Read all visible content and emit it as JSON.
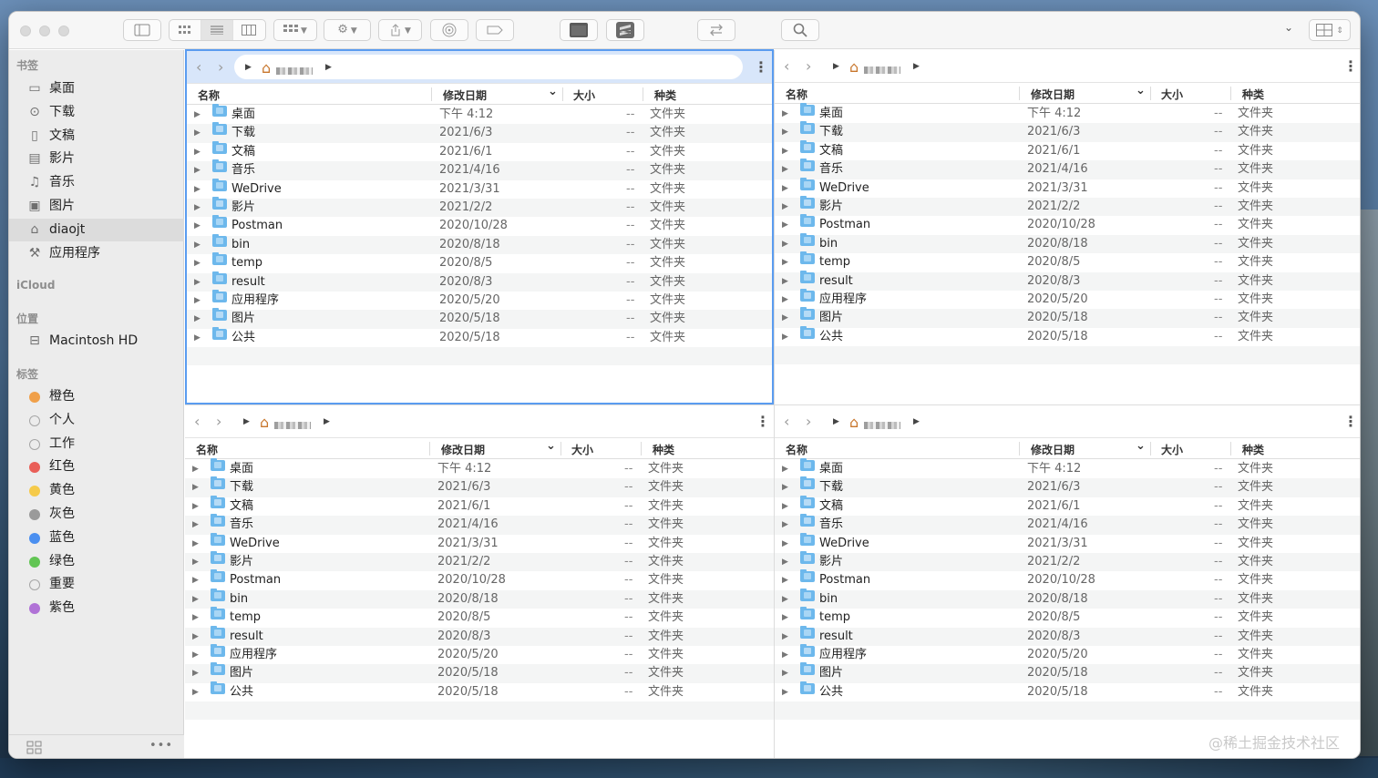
{
  "sidebar": {
    "favorites_header": "书签",
    "favorites": [
      {
        "label": "桌面",
        "icon": "desktop-icon",
        "glyph": "▭"
      },
      {
        "label": "下载",
        "icon": "download-icon",
        "glyph": "⊙"
      },
      {
        "label": "文稿",
        "icon": "document-icon",
        "glyph": "▯"
      },
      {
        "label": "影片",
        "icon": "film-icon",
        "glyph": "▤"
      },
      {
        "label": "音乐",
        "icon": "music-icon",
        "glyph": "♫"
      },
      {
        "label": "图片",
        "icon": "photo-icon",
        "glyph": "▣"
      },
      {
        "label": "diaojt",
        "icon": "home-icon",
        "glyph": "⌂"
      },
      {
        "label": "应用程序",
        "icon": "apps-icon",
        "glyph": "⚒"
      }
    ],
    "icloud_header": "iCloud",
    "locations_header": "位置",
    "locations": [
      {
        "label": "Macintosh HD",
        "icon": "disk-icon",
        "glyph": "⊟"
      }
    ],
    "tags_header": "标签",
    "tags": [
      {
        "label": "橙色",
        "color": "#f0a04a"
      },
      {
        "label": "个人",
        "color": ""
      },
      {
        "label": "工作",
        "color": ""
      },
      {
        "label": "红色",
        "color": "#e95f58"
      },
      {
        "label": "黄色",
        "color": "#f5ca4a"
      },
      {
        "label": "灰色",
        "color": "#9a9a9a"
      },
      {
        "label": "蓝色",
        "color": "#4a8ff0"
      },
      {
        "label": "绿色",
        "color": "#62c554"
      },
      {
        "label": "重要",
        "color": ""
      },
      {
        "label": "紫色",
        "color": "#b072d6"
      }
    ],
    "footer_more": "•••"
  },
  "columns": {
    "name": "名称",
    "date": "修改日期",
    "size": "大小",
    "kind": "种类"
  },
  "files": [
    {
      "name": "桌面",
      "date": "下午 4:12",
      "size": "--",
      "kind": "文件夹"
    },
    {
      "name": "下载",
      "date": "2021/6/3",
      "size": "--",
      "kind": "文件夹"
    },
    {
      "name": "文稿",
      "date": "2021/6/1",
      "size": "--",
      "kind": "文件夹"
    },
    {
      "name": "音乐",
      "date": "2021/4/16",
      "size": "--",
      "kind": "文件夹"
    },
    {
      "name": "WeDrive",
      "date": "2021/3/31",
      "size": "--",
      "kind": "文件夹"
    },
    {
      "name": "影片",
      "date": "2021/2/2",
      "size": "--",
      "kind": "文件夹"
    },
    {
      "name": "Postman",
      "date": "2020/10/28",
      "size": "--",
      "kind": "文件夹"
    },
    {
      "name": "bin",
      "date": "2020/8/18",
      "size": "--",
      "kind": "文件夹"
    },
    {
      "name": "temp",
      "date": "2020/8/5",
      "size": "--",
      "kind": "文件夹"
    },
    {
      "name": "result",
      "date": "2020/8/3",
      "size": "--",
      "kind": "文件夹"
    },
    {
      "name": "应用程序",
      "date": "2020/5/20",
      "size": "--",
      "kind": "文件夹"
    },
    {
      "name": "图片",
      "date": "2020/5/18",
      "size": "--",
      "kind": "文件夹"
    },
    {
      "name": "公共",
      "date": "2020/5/18",
      "size": "--",
      "kind": "文件夹"
    }
  ],
  "pane_icons": {
    "back": "‹",
    "forward": "›",
    "disclosure": "▶",
    "more": "⋮",
    "sort_chevron": "⌄",
    "home": "⌂"
  },
  "watermark": "@稀土掘金技术社区",
  "colors": {
    "accent": "#5a9cf0",
    "folder": "#6db8ec",
    "focused_bar": "#d8e6fa"
  }
}
